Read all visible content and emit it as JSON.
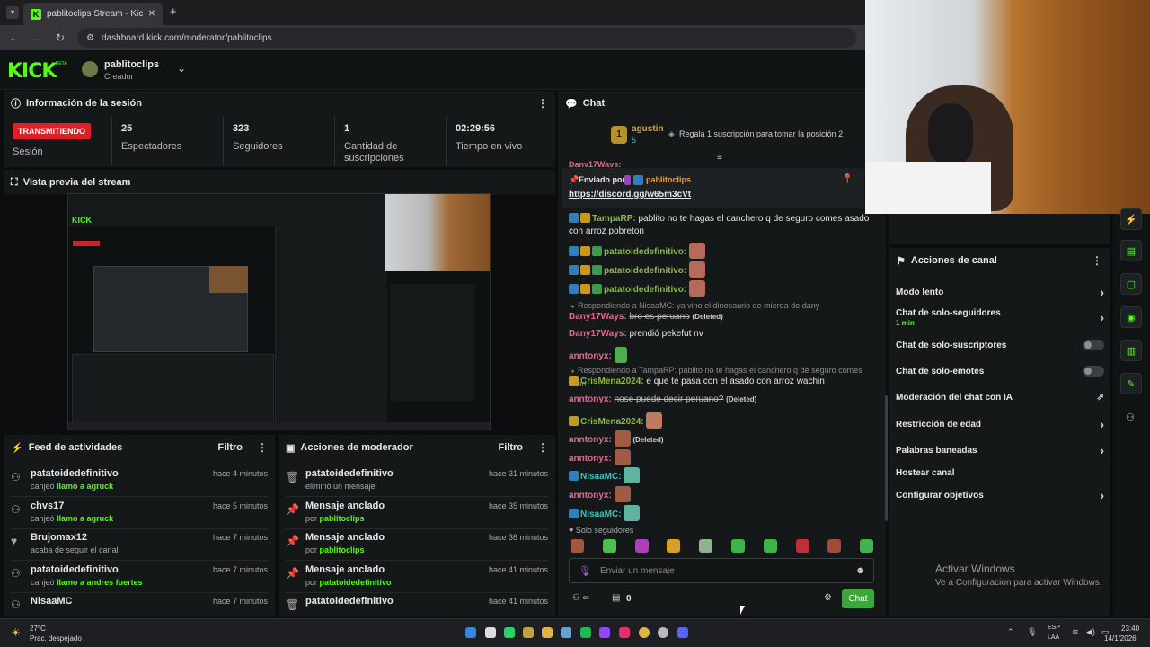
{
  "browser": {
    "tab_title": "pablitoclips Stream - Kick Dashb",
    "url": "dashboard.kick.com/moderator/pablitoclips"
  },
  "header": {
    "logo": "KICK",
    "beta": "BETA",
    "channel_name": "pablitoclips",
    "channel_role": "Creador"
  },
  "session": {
    "title": "Información de la sesión",
    "status_badge": "TRANSMITIENDO",
    "status_label": "Sesión",
    "stats": [
      {
        "value": "25",
        "label": "Espectadores"
      },
      {
        "value": "323",
        "label": "Seguidores"
      },
      {
        "value": "1",
        "label": "Cantidad de suscripciones"
      },
      {
        "value": "02:29:56",
        "label": "Tiempo en vivo"
      }
    ]
  },
  "preview": {
    "title": "Vista previa del stream"
  },
  "activity": {
    "title": "Feed de actividades",
    "filter": "Filtro",
    "items": [
      {
        "name": "patatoidedefinitivo",
        "pre": "canjeó",
        "link": "llamo a agruck",
        "time": "hace 4 minutos",
        "icon": "reward-icon"
      },
      {
        "name": "chvs17",
        "pre": "canjeó",
        "link": "llamo a agruck",
        "time": "hace 5 minutos",
        "icon": "reward-icon"
      },
      {
        "name": "Brujomax12",
        "pre": "acaba de seguir el canal",
        "link": "",
        "time": "hace 7 minutos",
        "icon": "heart-icon"
      },
      {
        "name": "patatoidedefinitivo",
        "pre": "canjeó",
        "link": "llamo a andres fuertes",
        "time": "hace 7 minutos",
        "icon": "reward-icon"
      },
      {
        "name": "NisaaMC",
        "pre": "",
        "link": "",
        "time": "hace 7 minutos",
        "icon": "reward-icon"
      }
    ]
  },
  "modactions": {
    "title": "Acciones de moderador",
    "filter": "Filtro",
    "items": [
      {
        "name": "patatoidedefinitivo",
        "pre": "eliminó un mensaje",
        "link": "",
        "time": "hace 31 minutos",
        "icon": "trash-icon"
      },
      {
        "name": "Mensaje anclado",
        "pre": "por",
        "link": "pablitoclips",
        "time": "hace 35 minutos",
        "icon": "pin-icon"
      },
      {
        "name": "Mensaje anclado",
        "pre": "por",
        "link": "pablitoclips",
        "time": "hace 36 minutos",
        "icon": "pin-icon"
      },
      {
        "name": "Mensaje anclado",
        "pre": "por",
        "link": "patatoidedefinitivo",
        "time": "hace 41 minutos",
        "icon": "pin-icon"
      },
      {
        "name": "patatoidedefinitivo",
        "pre": "",
        "link": "",
        "time": "hace 41 minutos",
        "icon": "trash-icon"
      }
    ]
  },
  "chat": {
    "title": "Chat",
    "top_gifter": {
      "rank": "1",
      "name": "agustin",
      "count": "5",
      "promo": "Regala 1 suscripción para tomar la posición 2"
    },
    "pinned_prev_user": "Dany17Ways:",
    "pinned": {
      "label": "Enviado por",
      "user": "pablitoclips",
      "message": "https://discord.gg/w65m3cVt"
    },
    "messages": [
      {
        "user": "TampaRP:",
        "text": "pablito no te hagas el canchero q de seguro comes asado con arroz pobreton"
      },
      {
        "user": "patatoidedefinitivo:",
        "text": ""
      },
      {
        "user": "patatoidedefinitivo:",
        "text": ""
      },
      {
        "user": "patatoidedefinitivo:",
        "text": ""
      },
      {
        "reply": "Respondiendo a NisaaMC: ya vino el dinosaurio de mierda de dany"
      },
      {
        "user": "Dany17Ways:",
        "text": "bro es peruano",
        "deleted": "(Deleted)"
      },
      {
        "user": "Dany17Ways:",
        "text": "prendió pekefut nv"
      },
      {
        "user": "anntonyx:",
        "text": ""
      },
      {
        "reply": "Respondiendo a TampaRP: pablito no te hagas el canchero q de seguro comes asad..."
      },
      {
        "user": "CrisMena2024:",
        "text": "e que te pasa con el asado con arroz wachin"
      },
      {
        "user": "anntonyx:",
        "text": "nose puede decir peruano?",
        "deleted": "(Deleted)"
      },
      {
        "user": "CrisMena2024:",
        "text": ""
      },
      {
        "user": "anntonyx:",
        "text": "",
        "deleted": "(Deleted)"
      },
      {
        "user": "anntonyx:",
        "text": ""
      },
      {
        "user": "NisaaMC:",
        "text": ""
      },
      {
        "user": "anntonyx:",
        "text": ""
      },
      {
        "user": "NisaaMC:",
        "text": ""
      }
    ],
    "followers_only": "Solo seguidores",
    "input_placeholder": "Enviar un mensaje",
    "bottom_count": "0",
    "send_label": "Chat"
  },
  "channel_actions": {
    "title": "Acciones de canal",
    "items": [
      {
        "label": "Modo lento",
        "control": "chevron"
      },
      {
        "label": "Chat de solo-seguidores",
        "sub": "1 min",
        "control": "chevron"
      },
      {
        "label": "Chat de solo-suscriptores",
        "control": "toggle"
      },
      {
        "label": "Chat de solo-emotes",
        "control": "toggle"
      },
      {
        "label": "Moderación del chat con IA",
        "control": "external"
      },
      {
        "label": "Restricción de edad",
        "control": "chevron"
      },
      {
        "label": "Palabras baneadas",
        "control": "chevron"
      },
      {
        "label": "Hostear canal",
        "control": "none"
      },
      {
        "label": "Configurar objetivos",
        "control": "chevron"
      }
    ]
  },
  "windows_watermark": {
    "title": "Activar Windows",
    "subtitle": "Ve a Configuración para activar Windows."
  },
  "taskbar": {
    "weather_temp": "27°C",
    "weather_desc": "Prac. despejado",
    "lang": "ESP",
    "lang_sub": "LAA",
    "time": "23:40",
    "date": "14/1/2026"
  }
}
